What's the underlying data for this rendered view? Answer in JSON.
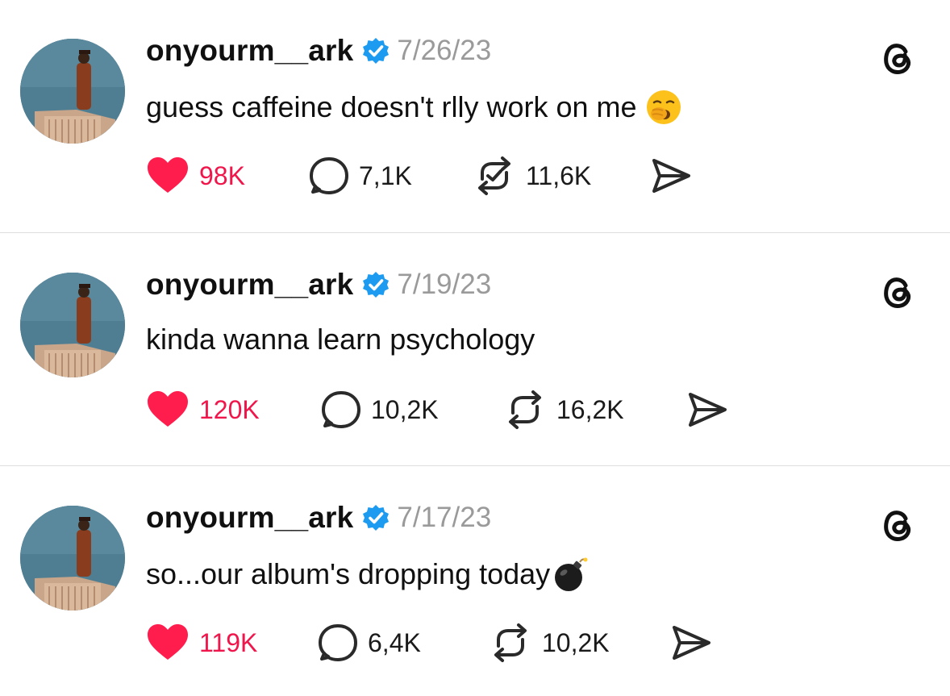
{
  "colors": {
    "like_red": "#FF1D4D",
    "verified_blue": "#1D9BF0",
    "date_gray": "#9A9A9A",
    "divider": "#DEDEDE"
  },
  "icons": {
    "like": "heart-icon",
    "reply": "comment-bubble-icon",
    "repost": "repost-icon",
    "share": "send-icon",
    "brand": "threads-logo-icon",
    "verified": "verified-badge-icon"
  },
  "posts": [
    {
      "username": "onyourm__ark",
      "date": "7/26/23",
      "text": "guess caffeine doesn't rlly work on me",
      "emoji": "yawning-face",
      "likes": "98K",
      "replies": "7,1K",
      "reposts": "11,6K",
      "liked": true
    },
    {
      "username": "onyourm__ark",
      "date": "7/19/23",
      "text": "kinda wanna learn psychology",
      "emoji": "",
      "likes": "120K",
      "replies": "10,2K",
      "reposts": "16,2K",
      "liked": true
    },
    {
      "username": "onyourm__ark",
      "date": "7/17/23",
      "text": "so...our album's dropping today",
      "emoji": "bomb",
      "likes": "119K",
      "replies": "6,4K",
      "reposts": "10,2K",
      "liked": true
    }
  ]
}
